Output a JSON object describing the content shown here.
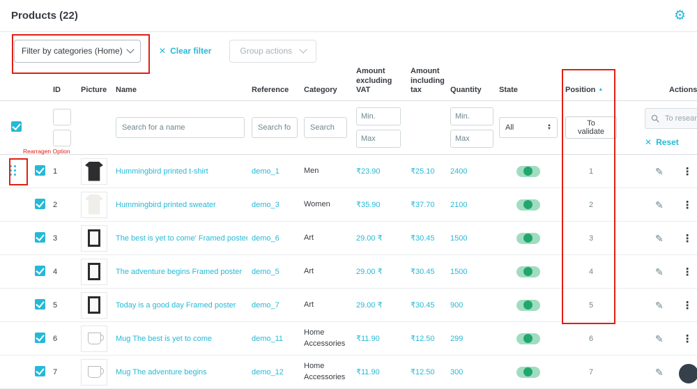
{
  "page": {
    "title": "Products (22)"
  },
  "filterbar": {
    "category_filter_label": "Filter by categories (Home)",
    "clear_filter_label": "Clear filter",
    "group_actions_label": "Group actions"
  },
  "annotations": {
    "rearrange_note": "Rearragen Option"
  },
  "table": {
    "headers": {
      "id": "ID",
      "picture": "Picture",
      "name": "Name",
      "reference": "Reference",
      "category": "Category",
      "amount_excl": "Amount excluding VAT",
      "amount_incl": "Amount including tax",
      "quantity": "Quantity",
      "state": "State",
      "position": "Position",
      "actions": "Actions"
    },
    "filter_row": {
      "name_placeholder": "Search for a name",
      "reference_placeholder": "Search fo",
      "category_placeholder": "Search",
      "min_label": "Min.",
      "max_label": "Max",
      "state_value": "All",
      "position_button_label": "To validate",
      "search_placeholder": "To research",
      "reset_label": "Reset"
    },
    "rows": [
      {
        "id": "1",
        "thumb": "tshirt",
        "name": "Hummingbird printed t-shirt",
        "reference": "demo_1",
        "category": "Men",
        "amount_excl": "₹23.90",
        "amount_incl": "₹25.10",
        "quantity": "2400",
        "position": "1"
      },
      {
        "id": "2",
        "thumb": "sweater",
        "name": "Hummingbird printed sweater",
        "reference": "demo_3",
        "category": "Women",
        "amount_excl": "₹35.90",
        "amount_incl": "₹37.70",
        "quantity": "2100",
        "position": "2"
      },
      {
        "id": "3",
        "thumb": "poster",
        "name": "The best is yet to come' Framed poster",
        "reference": "demo_6",
        "category": "Art",
        "amount_excl": "29.00 ₹",
        "amount_incl": "₹30.45",
        "quantity": "1500",
        "position": "3"
      },
      {
        "id": "4",
        "thumb": "poster",
        "name": "The adventure begins Framed poster",
        "reference": "demo_5",
        "category": "Art",
        "amount_excl": "29.00 ₹",
        "amount_incl": "₹30.45",
        "quantity": "1500",
        "position": "4"
      },
      {
        "id": "5",
        "thumb": "poster",
        "name": "Today is a good day Framed poster",
        "reference": "demo_7",
        "category": "Art",
        "amount_excl": "29.00 ₹",
        "amount_incl": "₹30.45",
        "quantity": "900",
        "position": "5"
      },
      {
        "id": "6",
        "thumb": "mug",
        "name": "Mug The best is yet to come",
        "reference": "demo_11",
        "category": "Home Accessories",
        "amount_excl": "₹11.90",
        "amount_incl": "₹12.50",
        "quantity": "299",
        "position": "6"
      },
      {
        "id": "7",
        "thumb": "mug",
        "name": "Mug The adventure begins",
        "reference": "demo_12",
        "category": "Home Accessories",
        "amount_excl": "₹11.90",
        "amount_incl": "₹12.50",
        "quantity": "300",
        "position": "7"
      }
    ]
  },
  "colors": {
    "accent": "#25b9d7",
    "toggle_green": "#23a56f",
    "annotation_red": "#e11e12"
  }
}
